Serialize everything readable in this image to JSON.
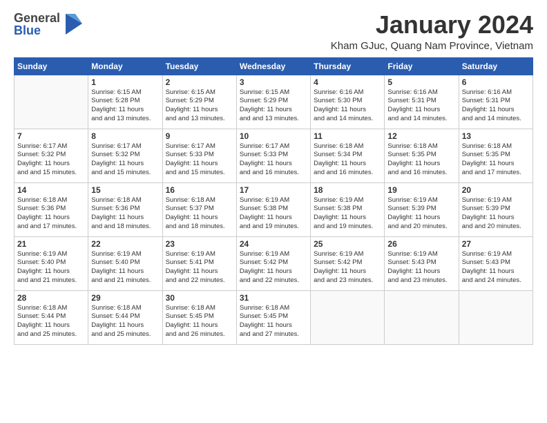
{
  "logo": {
    "general": "General",
    "blue": "Blue"
  },
  "header": {
    "title": "January 2024",
    "location": "Kham GJuc, Quang Nam Province, Vietnam"
  },
  "days_of_week": [
    "Sunday",
    "Monday",
    "Tuesday",
    "Wednesday",
    "Thursday",
    "Friday",
    "Saturday"
  ],
  "weeks": [
    [
      {
        "day": "",
        "sunrise": "",
        "sunset": "",
        "daylight": ""
      },
      {
        "day": "1",
        "sunrise": "Sunrise: 6:15 AM",
        "sunset": "Sunset: 5:28 PM",
        "daylight": "Daylight: 11 hours and 13 minutes."
      },
      {
        "day": "2",
        "sunrise": "Sunrise: 6:15 AM",
        "sunset": "Sunset: 5:29 PM",
        "daylight": "Daylight: 11 hours and 13 minutes."
      },
      {
        "day": "3",
        "sunrise": "Sunrise: 6:15 AM",
        "sunset": "Sunset: 5:29 PM",
        "daylight": "Daylight: 11 hours and 13 minutes."
      },
      {
        "day": "4",
        "sunrise": "Sunrise: 6:16 AM",
        "sunset": "Sunset: 5:30 PM",
        "daylight": "Daylight: 11 hours and 14 minutes."
      },
      {
        "day": "5",
        "sunrise": "Sunrise: 6:16 AM",
        "sunset": "Sunset: 5:31 PM",
        "daylight": "Daylight: 11 hours and 14 minutes."
      },
      {
        "day": "6",
        "sunrise": "Sunrise: 6:16 AM",
        "sunset": "Sunset: 5:31 PM",
        "daylight": "Daylight: 11 hours and 14 minutes."
      }
    ],
    [
      {
        "day": "7",
        "sunrise": "Sunrise: 6:17 AM",
        "sunset": "Sunset: 5:32 PM",
        "daylight": "Daylight: 11 hours and 15 minutes."
      },
      {
        "day": "8",
        "sunrise": "Sunrise: 6:17 AM",
        "sunset": "Sunset: 5:32 PM",
        "daylight": "Daylight: 11 hours and 15 minutes."
      },
      {
        "day": "9",
        "sunrise": "Sunrise: 6:17 AM",
        "sunset": "Sunset: 5:33 PM",
        "daylight": "Daylight: 11 hours and 15 minutes."
      },
      {
        "day": "10",
        "sunrise": "Sunrise: 6:17 AM",
        "sunset": "Sunset: 5:33 PM",
        "daylight": "Daylight: 11 hours and 16 minutes."
      },
      {
        "day": "11",
        "sunrise": "Sunrise: 6:18 AM",
        "sunset": "Sunset: 5:34 PM",
        "daylight": "Daylight: 11 hours and 16 minutes."
      },
      {
        "day": "12",
        "sunrise": "Sunrise: 6:18 AM",
        "sunset": "Sunset: 5:35 PM",
        "daylight": "Daylight: 11 hours and 16 minutes."
      },
      {
        "day": "13",
        "sunrise": "Sunrise: 6:18 AM",
        "sunset": "Sunset: 5:35 PM",
        "daylight": "Daylight: 11 hours and 17 minutes."
      }
    ],
    [
      {
        "day": "14",
        "sunrise": "Sunrise: 6:18 AM",
        "sunset": "Sunset: 5:36 PM",
        "daylight": "Daylight: 11 hours and 17 minutes."
      },
      {
        "day": "15",
        "sunrise": "Sunrise: 6:18 AM",
        "sunset": "Sunset: 5:36 PM",
        "daylight": "Daylight: 11 hours and 18 minutes."
      },
      {
        "day": "16",
        "sunrise": "Sunrise: 6:18 AM",
        "sunset": "Sunset: 5:37 PM",
        "daylight": "Daylight: 11 hours and 18 minutes."
      },
      {
        "day": "17",
        "sunrise": "Sunrise: 6:19 AM",
        "sunset": "Sunset: 5:38 PM",
        "daylight": "Daylight: 11 hours and 19 minutes."
      },
      {
        "day": "18",
        "sunrise": "Sunrise: 6:19 AM",
        "sunset": "Sunset: 5:38 PM",
        "daylight": "Daylight: 11 hours and 19 minutes."
      },
      {
        "day": "19",
        "sunrise": "Sunrise: 6:19 AM",
        "sunset": "Sunset: 5:39 PM",
        "daylight": "Daylight: 11 hours and 20 minutes."
      },
      {
        "day": "20",
        "sunrise": "Sunrise: 6:19 AM",
        "sunset": "Sunset: 5:39 PM",
        "daylight": "Daylight: 11 hours and 20 minutes."
      }
    ],
    [
      {
        "day": "21",
        "sunrise": "Sunrise: 6:19 AM",
        "sunset": "Sunset: 5:40 PM",
        "daylight": "Daylight: 11 hours and 21 minutes."
      },
      {
        "day": "22",
        "sunrise": "Sunrise: 6:19 AM",
        "sunset": "Sunset: 5:40 PM",
        "daylight": "Daylight: 11 hours and 21 minutes."
      },
      {
        "day": "23",
        "sunrise": "Sunrise: 6:19 AM",
        "sunset": "Sunset: 5:41 PM",
        "daylight": "Daylight: 11 hours and 22 minutes."
      },
      {
        "day": "24",
        "sunrise": "Sunrise: 6:19 AM",
        "sunset": "Sunset: 5:42 PM",
        "daylight": "Daylight: 11 hours and 22 minutes."
      },
      {
        "day": "25",
        "sunrise": "Sunrise: 6:19 AM",
        "sunset": "Sunset: 5:42 PM",
        "daylight": "Daylight: 11 hours and 23 minutes."
      },
      {
        "day": "26",
        "sunrise": "Sunrise: 6:19 AM",
        "sunset": "Sunset: 5:43 PM",
        "daylight": "Daylight: 11 hours and 23 minutes."
      },
      {
        "day": "27",
        "sunrise": "Sunrise: 6:19 AM",
        "sunset": "Sunset: 5:43 PM",
        "daylight": "Daylight: 11 hours and 24 minutes."
      }
    ],
    [
      {
        "day": "28",
        "sunrise": "Sunrise: 6:18 AM",
        "sunset": "Sunset: 5:44 PM",
        "daylight": "Daylight: 11 hours and 25 minutes."
      },
      {
        "day": "29",
        "sunrise": "Sunrise: 6:18 AM",
        "sunset": "Sunset: 5:44 PM",
        "daylight": "Daylight: 11 hours and 25 minutes."
      },
      {
        "day": "30",
        "sunrise": "Sunrise: 6:18 AM",
        "sunset": "Sunset: 5:45 PM",
        "daylight": "Daylight: 11 hours and 26 minutes."
      },
      {
        "day": "31",
        "sunrise": "Sunrise: 6:18 AM",
        "sunset": "Sunset: 5:45 PM",
        "daylight": "Daylight: 11 hours and 27 minutes."
      },
      {
        "day": "",
        "sunrise": "",
        "sunset": "",
        "daylight": ""
      },
      {
        "day": "",
        "sunrise": "",
        "sunset": "",
        "daylight": ""
      },
      {
        "day": "",
        "sunrise": "",
        "sunset": "",
        "daylight": ""
      }
    ]
  ]
}
